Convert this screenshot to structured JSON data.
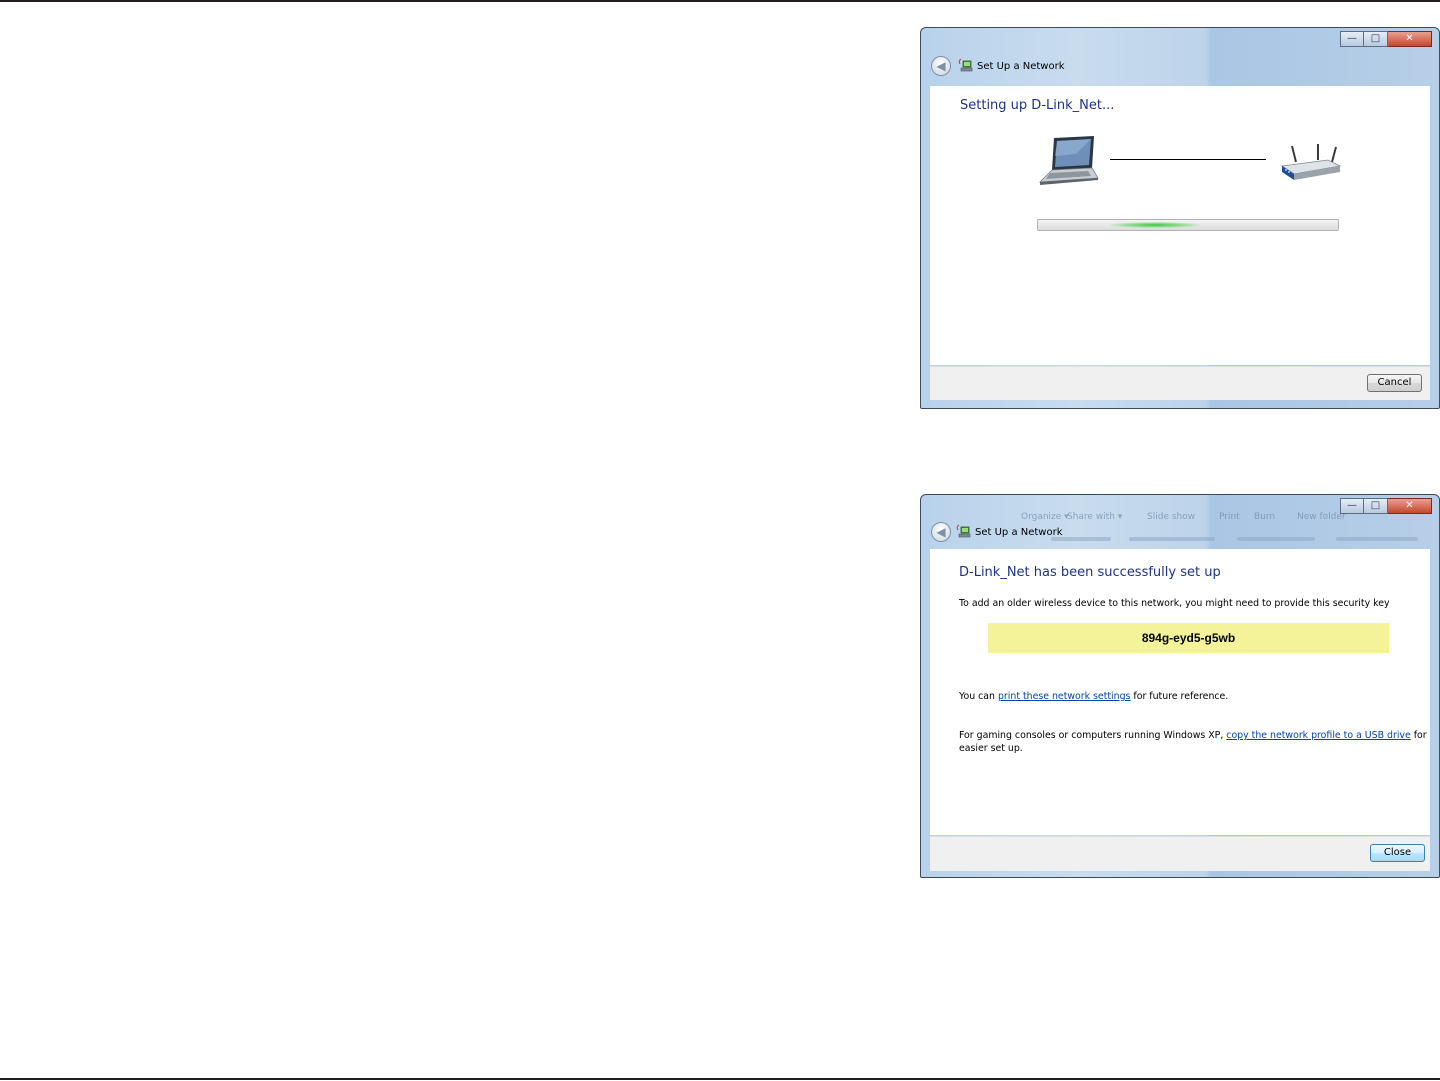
{
  "dialog_progress": {
    "title": "Set Up a Network",
    "heading": "Setting up D-Link_Net...",
    "cancel_label": "Cancel",
    "progress_style": "indeterminate",
    "icons": [
      "back-arrow-icon",
      "network-setup-icon",
      "laptop-icon",
      "wireless-router-icon"
    ]
  },
  "dialog_success": {
    "title": "Set Up a Network",
    "heading": "D-Link_Net has been successfully set up",
    "security_key_intro": "To add an older wireless device to this network, you might need to provide this security key",
    "security_key": "894g-eyd5-g5wb",
    "print_prefix": "You can ",
    "print_link": "print these network settings",
    "print_suffix": " for future reference.",
    "usb_prefix": "For gaming consoles or computers running Windows XP, ",
    "usb_link": "copy the network profile to a USB drive",
    "usb_suffix": " for",
    "usb_line2": "easier set up.",
    "close_label": "Close",
    "background_toolbar": [
      "Organize ▾",
      "Share with ▾",
      "Slide show",
      "Print",
      "Burn",
      "New folder"
    ]
  },
  "colors": {
    "heading_blue": "#1e3287",
    "link_blue": "#0645ad",
    "key_highlight": "#f4f39a",
    "progress_green": "#3ec73e"
  },
  "window_controls": {
    "minimize": "—",
    "maximize": "□",
    "close": "✕"
  }
}
